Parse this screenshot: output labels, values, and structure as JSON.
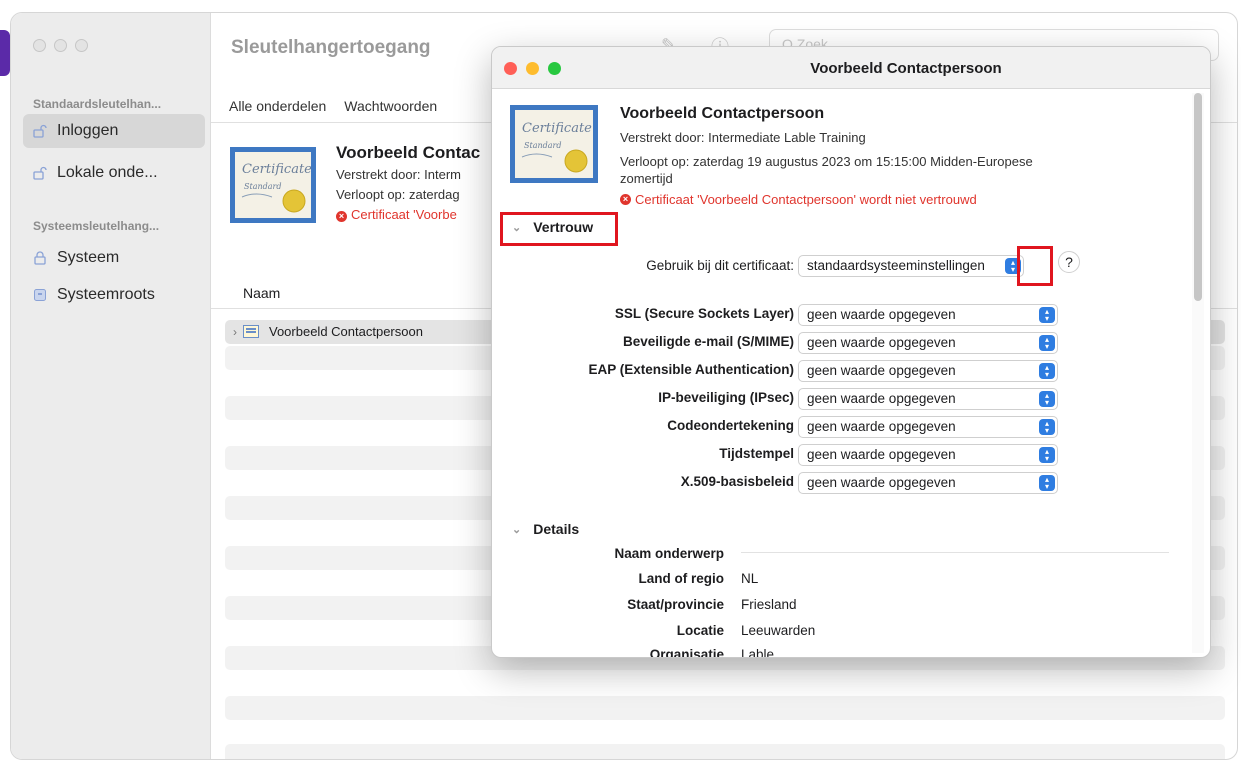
{
  "keychain_window": {
    "title": "Sleutelhangertoegang",
    "search_placeholder": "Q Zoek",
    "sidebar": {
      "section_default": "Standaardsleutelhan...",
      "items_default": [
        {
          "label": "Inloggen",
          "icon": "lock-open-icon",
          "selected": true
        },
        {
          "label": "Lokale onde...",
          "icon": "lock-open-icon",
          "selected": false
        }
      ],
      "section_system": "Systeemsleutelhang...",
      "items_system": [
        {
          "label": "Systeem",
          "icon": "lock-icon"
        },
        {
          "label": "Systeemroots",
          "icon": "cabinet-icon"
        }
      ]
    },
    "tabs": [
      "Alle onderdelen",
      "Wachtwoorden"
    ],
    "summary": {
      "title": "Voorbeeld Contac",
      "issued": "Verstrekt door: Interm",
      "expires": "Verloopt op: zaterdag",
      "error": "Certificaat 'Voorbe"
    },
    "column_name": "Naam",
    "rows": [
      {
        "label": "Voorbeeld Contactpersoon"
      }
    ]
  },
  "cert_window": {
    "title": "Voorbeeld Contactpersoon",
    "name": "Voorbeeld Contactpersoon",
    "issued_by": "Verstrekt door: Intermediate Lable Training",
    "expires": "Verloopt op: zaterdag 19 augustus 2023 om 15:15:00 Midden-Europese zomertijd",
    "error": "Certificaat 'Voorbeeld Contactpersoon' wordt niet vertrouwd",
    "trust": {
      "section_label": "Vertrouw",
      "use_label": "Gebruik bij dit certificaat:",
      "use_value": "standaardsysteeminstellingen",
      "rows": [
        {
          "label": "SSL (Secure Sockets Layer)",
          "value": "geen waarde opgegeven"
        },
        {
          "label": "Beveiligde e-mail (S/MIME)",
          "value": "geen waarde opgegeven"
        },
        {
          "label": "EAP (Extensible Authentication)",
          "value": "geen waarde opgegeven"
        },
        {
          "label": "IP-beveiliging (IPsec)",
          "value": "geen waarde opgegeven"
        },
        {
          "label": "Codeondertekening",
          "value": "geen waarde opgegeven"
        },
        {
          "label": "Tijdstempel",
          "value": "geen waarde opgegeven"
        },
        {
          "label": "X.509-basisbeleid",
          "value": "geen waarde opgegeven"
        }
      ]
    },
    "details": {
      "section_label": "Details",
      "subject_label": "Naam onderwerp",
      "rows": [
        {
          "label": "Land of regio",
          "value": "NL"
        },
        {
          "label": "Staat/provincie",
          "value": "Friesland"
        },
        {
          "label": "Locatie",
          "value": "Leeuwarden"
        },
        {
          "label": "Organisatie",
          "value": "Lable"
        }
      ]
    }
  },
  "colors": {
    "accent": "#2f7de1",
    "error": "#e0352d",
    "highlight": "#e0161f"
  }
}
